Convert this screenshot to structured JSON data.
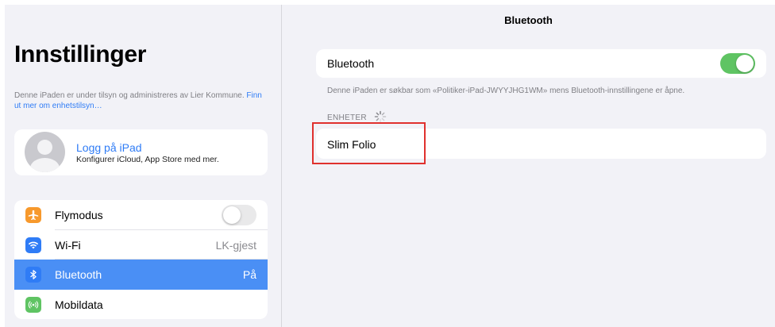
{
  "sidebar": {
    "title": "Innstillinger",
    "supervision_text": "Denne iPaden er under tilsyn og administreres av Lier Kommune.",
    "supervision_link": "Finn ut mer om enhetstilsyn…",
    "profile": {
      "name": "Logg på iPad",
      "subtitle": "Konfigurer iCloud, App Store med mer."
    },
    "items": [
      {
        "label": "Flymodus",
        "icon": "airplane-icon",
        "icon_color": "#f7992c",
        "control": "toggle-off"
      },
      {
        "label": "Wi-Fi",
        "icon": "wifi-icon",
        "icon_color": "#2f7cf6",
        "value": "LK-gjest"
      },
      {
        "label": "Bluetooth",
        "icon": "bluetooth-icon",
        "icon_color": "#2f7cf6",
        "value": "På",
        "selected": true
      },
      {
        "label": "Mobildata",
        "icon": "cellular-icon",
        "icon_color": "#5fc463"
      }
    ]
  },
  "detail": {
    "title": "Bluetooth",
    "bluetooth_label": "Bluetooth",
    "bluetooth_on": true,
    "footer": "Denne iPaden er søkbar som «Politiker-iPad-JWYYJHG1WM» mens Bluetooth-innstillingene er åpne.",
    "devices_header": "ENHETER",
    "devices": [
      {
        "name": "Slim Folio"
      }
    ]
  },
  "colors": {
    "accent": "#2f7cf6",
    "selected_row": "#4a8ff5",
    "toggle_on": "#5fc463",
    "highlight": "#e0312e",
    "background": "#f2f2f7"
  }
}
